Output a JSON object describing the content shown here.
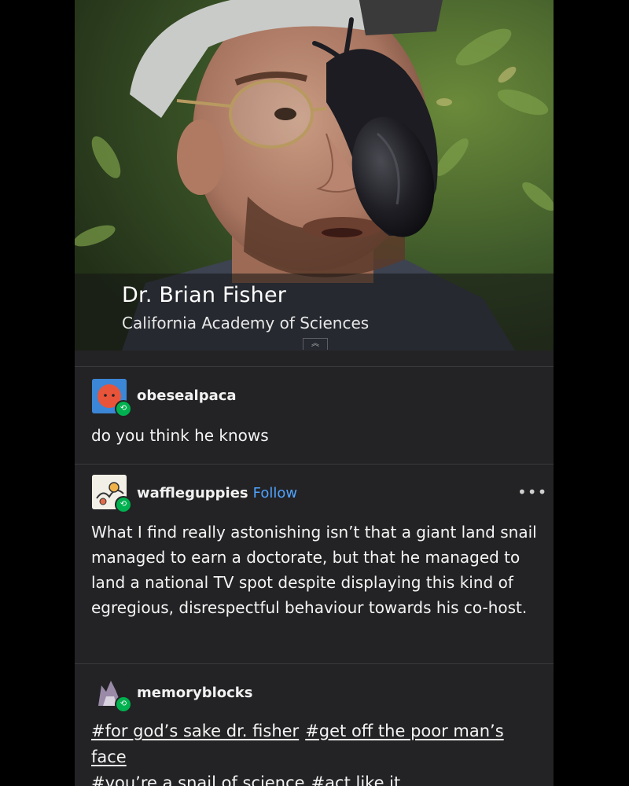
{
  "video": {
    "caption_name": "Dr. Brian Fisher",
    "caption_org": "California Academy of Sciences",
    "expand_glyph": "︽"
  },
  "posts": [
    {
      "username": "obesealpaca",
      "avatar_icon": "red-face-avatar-icon",
      "text": "do you think he knows"
    },
    {
      "username": "waffleguppies",
      "follow_label": "Follow",
      "more_label": "•••",
      "avatar_icon": "comic-avatar-icon",
      "text": "What I find really astonishing isn’t that a giant land snail managed to earn a doctorate, but that he managed to land a national TV spot despite displaying this kind of egregious, disrespectful behaviour towards his co-host."
    },
    {
      "username": "memoryblocks",
      "avatar_icon": "wolf-avatar-icon",
      "tags": [
        "#for god’s sake dr. fisher",
        "#get off the poor man’s face",
        "#you’re a snail of science",
        "#act like it"
      ]
    }
  ],
  "colors": {
    "background": "#232325",
    "link": "#4fa3ff",
    "reblog_badge": "#00b14f"
  }
}
